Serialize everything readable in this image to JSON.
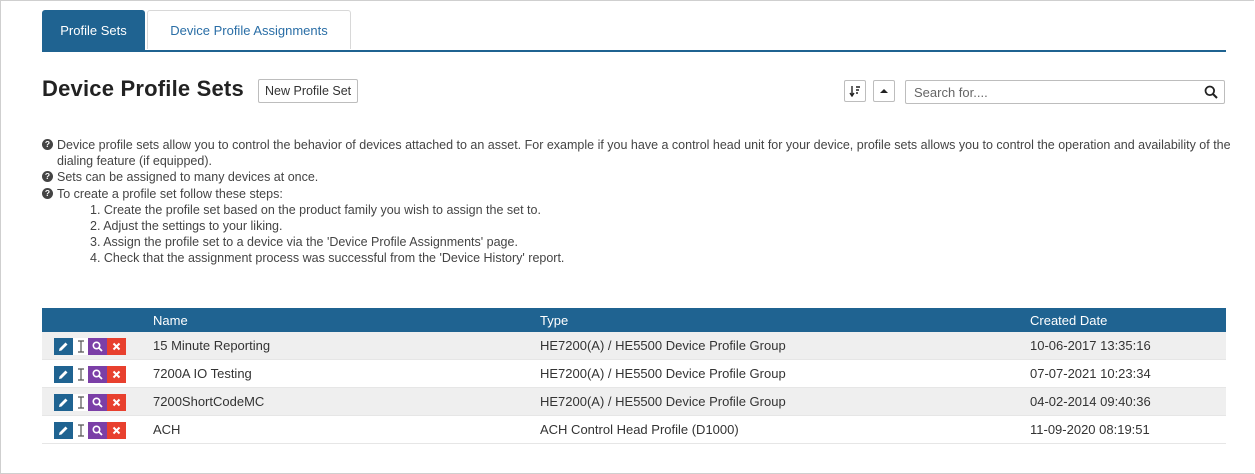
{
  "tabs": [
    {
      "label": "Profile Sets",
      "active": true
    },
    {
      "label": "Device Profile Assignments",
      "active": false
    }
  ],
  "header": {
    "title": "Device Profile Sets",
    "new_button": "New Profile Set",
    "sort_icon": "sort-descending-icon",
    "collapse_icon": "caret-up-icon"
  },
  "search": {
    "placeholder": "Search for....",
    "value": "",
    "icon": "search-icon"
  },
  "info": {
    "line1": "Device profile sets allow you to control the behavior of devices attached to an asset. For example if you have a control head unit for your device, profile sets allows you to control the operation and availability of the dialing feature (if equipped).",
    "line2": "Sets can be assigned to many devices at once.",
    "line3": "To create a profile set follow these steps:",
    "steps": [
      "1. Create the profile set based on the product family you wish to assign the set to.",
      "2. Adjust the settings to your liking.",
      "3. Assign the profile set to a device via the 'Device Profile Assignments' page.",
      "4. Check that the assignment process was successful from the 'Device History' report."
    ]
  },
  "table": {
    "columns": [
      "Name",
      "Type",
      "Created Date"
    ],
    "rows": [
      {
        "name": "15 Minute Reporting",
        "type": "HE7200(A) / HE5500 Device Profile Group",
        "created": "10-06-2017 13:35:16"
      },
      {
        "name": "7200A IO Testing",
        "type": "HE7200(A) / HE5500 Device Profile Group",
        "created": "07-07-2021 10:23:34"
      },
      {
        "name": "7200ShortCodeMC",
        "type": "HE7200(A) / HE5500 Device Profile Group",
        "created": "04-02-2014 09:40:36"
      },
      {
        "name": "ACH",
        "type": "ACH Control Head Profile (D1000)",
        "created": "11-09-2020 08:19:51"
      }
    ]
  },
  "colors": {
    "primary": "#1f6391",
    "view": "#7b3fa7",
    "delete": "#e8402e",
    "row_alt": "#efefef"
  }
}
